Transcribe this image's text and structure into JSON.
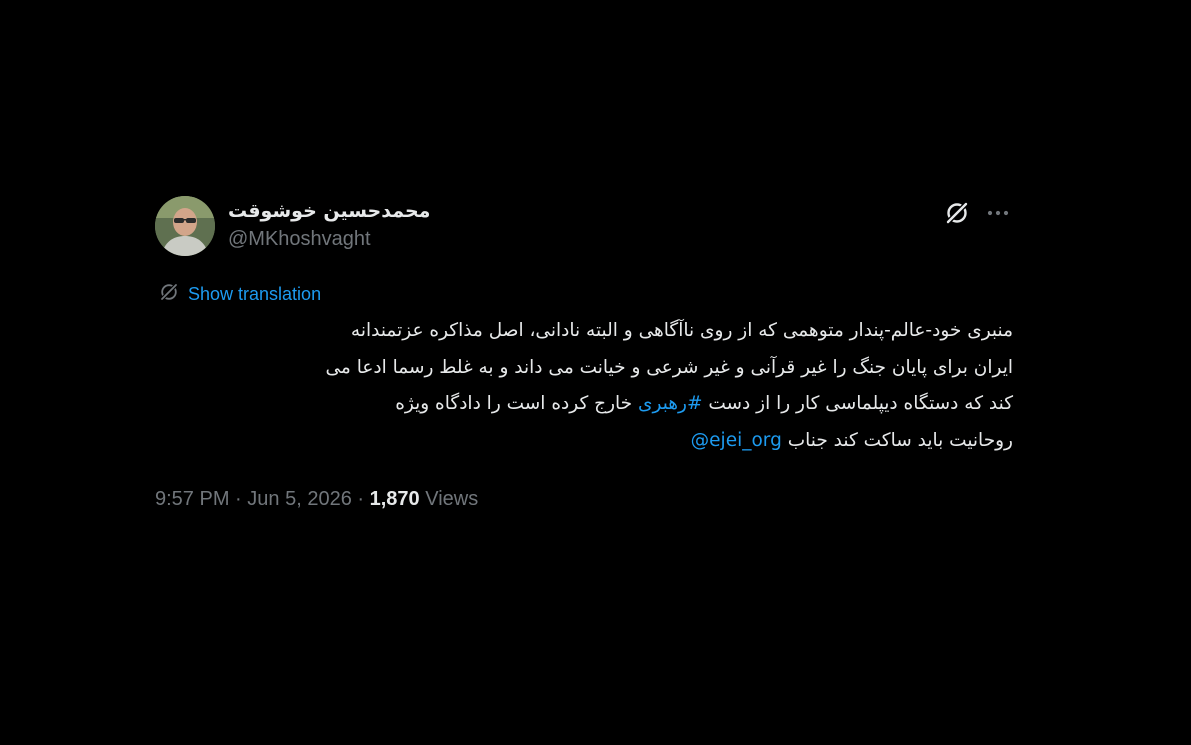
{
  "author": {
    "display_name": "محمدحسین خوشوقت",
    "handle": "@MKhoshvaght"
  },
  "icons": {
    "grok": "grok-icon",
    "more": "more-icon",
    "translate": "grok-translate-icon"
  },
  "translation": {
    "label": "Show translation"
  },
  "body": {
    "line1": "منبری خود-عالم-پندار متوهمی که از روی ناآگاهی و البته نادانی، اصل مذاکره عزتمندانه",
    "line2": "ایران برای پایان جنگ را غیر قرآنی و غیر شرعی و خیانت می داند و به غلط رسما ادعا می",
    "line3_before": "کند که دستگاه دیپلماسی کار را از دست",
    "line3_hashtag": "#رهبری",
    "line3_after": "خارج کرده است را دادگاه ویژه",
    "line4_text": "روحانیت باید ساکت کند جناب",
    "line4_mention": "@ejei_org"
  },
  "meta": {
    "time": "9:57 PM",
    "separator": "·",
    "date": "Jun 5, 2026",
    "views_count": "1,870",
    "views_label": "Views"
  },
  "colors": {
    "background": "#000000",
    "text": "#e7e9ea",
    "secondary": "#71767b",
    "link": "#1d9bf0"
  }
}
